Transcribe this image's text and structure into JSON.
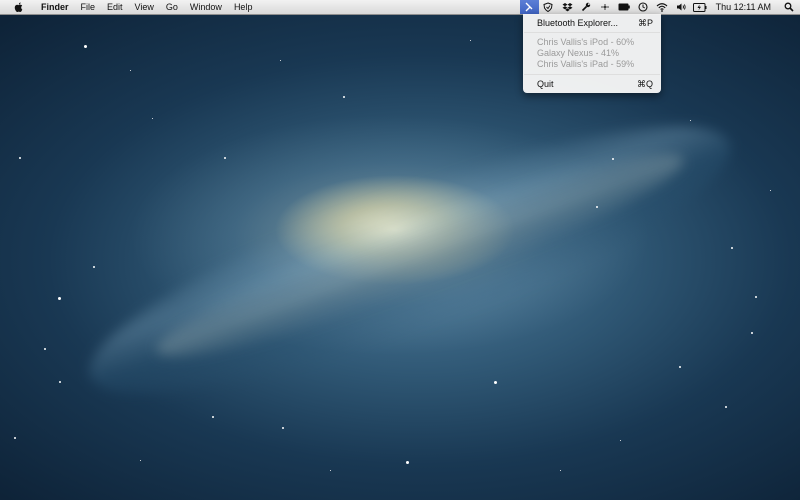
{
  "menubar": {
    "apple_icon": "apple-logo-icon",
    "items": [
      "Finder",
      "File",
      "Edit",
      "View",
      "Go",
      "Window",
      "Help"
    ],
    "status_icons": [
      "bluetooth-explorer-icon",
      "shield-icon",
      "dropbox-icon",
      "wrench-icon",
      "bluetooth-icon",
      "battery-icon",
      "time-machine-icon",
      "wifi-icon",
      "volume-icon",
      "battery-charge-icon"
    ],
    "clock": "Thu 12:11 AM",
    "spotlight_icon": "spotlight-search-icon"
  },
  "dropdown": {
    "primary": {
      "label": "Bluetooth Explorer...",
      "shortcut": "⌘P"
    },
    "devices": [
      "Chris Vallis's iPod - 60%",
      "Galaxy Nexus - 41%",
      "Chris Vallis's iPad - 59%"
    ],
    "quit": {
      "label": "Quit",
      "shortcut": "⌘Q"
    }
  },
  "colors": {
    "menu_highlight": "#4a6fcf",
    "disabled_text": "#9a9a9a",
    "space_dark": "#0e2338",
    "galaxy_core": "#fff6cd"
  }
}
